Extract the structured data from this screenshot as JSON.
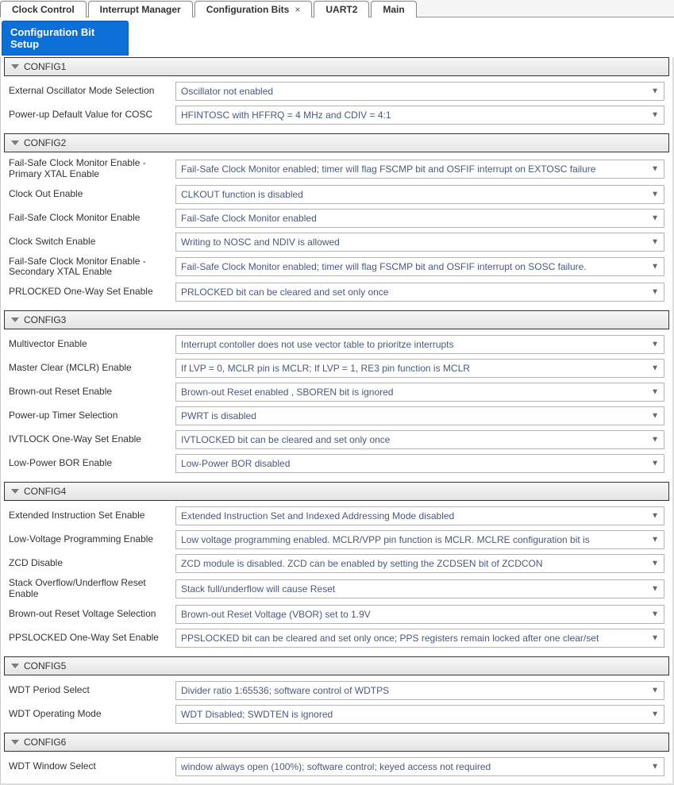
{
  "tabs": [
    {
      "label": "Clock Control",
      "active": false,
      "closable": false
    },
    {
      "label": "Interrupt Manager",
      "active": false,
      "closable": false
    },
    {
      "label": "Configuration Bits",
      "active": true,
      "closable": true
    },
    {
      "label": "UART2",
      "active": false,
      "closable": false
    },
    {
      "label": "Main",
      "active": false,
      "closable": false
    }
  ],
  "subheader": "Configuration Bit Setup",
  "sections": [
    {
      "title": "CONFIG1",
      "rows": [
        {
          "label": "External Oscillator Mode Selection",
          "value": "Oscillator not enabled"
        },
        {
          "label": "Power-up Default Value for COSC",
          "value": "HFINTOSC with HFFRQ = 4 MHz and CDIV = 4:1"
        }
      ]
    },
    {
      "title": "CONFIG2",
      "rows": [
        {
          "label": "Fail-Safe Clock Monitor Enable - Primary XTAL Enable",
          "value": "Fail-Safe Clock Monitor enabled; timer will flag FSCMP bit and OSFIF interrupt on EXTOSC failure"
        },
        {
          "label": "Clock Out Enable",
          "value": "CLKOUT function is disabled"
        },
        {
          "label": "Fail-Safe Clock Monitor Enable",
          "value": "Fail-Safe Clock Monitor enabled"
        },
        {
          "label": "Clock Switch Enable",
          "value": "Writing to NOSC and NDIV is allowed"
        },
        {
          "label": "Fail-Safe Clock Monitor Enable - Secondary XTAL Enable",
          "value": "Fail-Safe Clock Monitor enabled; timer will flag FSCMP bit and OSFIF interrupt on SOSC failure."
        },
        {
          "label": "PRLOCKED One-Way Set Enable",
          "value": "PRLOCKED bit can be cleared and set only once"
        }
      ]
    },
    {
      "title": "CONFIG3",
      "rows": [
        {
          "label": "Multivector Enable",
          "value": "Interrupt contoller does not use vector table to prioritze interrupts"
        },
        {
          "label": "Master Clear (MCLR) Enable",
          "value": "If LVP = 0, MCLR pin is MCLR; If LVP = 1, RE3 pin function is MCLR"
        },
        {
          "label": "Brown-out Reset Enable",
          "value": "Brown-out Reset enabled , SBOREN bit is ignored"
        },
        {
          "label": "Power-up Timer Selection",
          "value": "PWRT is disabled"
        },
        {
          "label": "IVTLOCK One-Way Set Enable",
          "value": "IVTLOCKED bit can be cleared and set only once"
        },
        {
          "label": "Low-Power BOR Enable",
          "value": "Low-Power BOR disabled"
        }
      ]
    },
    {
      "title": "CONFIG4",
      "rows": [
        {
          "label": "Extended Instruction Set Enable",
          "value": "Extended Instruction Set and Indexed Addressing Mode disabled"
        },
        {
          "label": "Low-Voltage Programming Enable",
          "value": "Low voltage programming enabled. MCLR/VPP pin function is MCLR. MCLRE configuration bit is"
        },
        {
          "label": "ZCD Disable",
          "value": "ZCD module is disabled. ZCD can be enabled by setting the ZCDSEN bit of ZCDCON"
        },
        {
          "label": "Stack Overflow/Underflow Reset Enable",
          "value": "Stack full/underflow will cause Reset"
        },
        {
          "label": "Brown-out Reset Voltage Selection",
          "value": "Brown-out Reset Voltage (VBOR) set to 1.9V"
        },
        {
          "label": "PPSLOCKED One-Way Set Enable",
          "value": "PPSLOCKED bit can be cleared and set only once; PPS registers remain locked after one clear/set"
        }
      ]
    },
    {
      "title": "CONFIG5",
      "rows": [
        {
          "label": "WDT Period Select",
          "value": "Divider ratio 1:65536; software control of WDTPS"
        },
        {
          "label": "WDT Operating Mode",
          "value": "WDT Disabled; SWDTEN is ignored"
        }
      ]
    },
    {
      "title": "CONFIG6",
      "rows": [
        {
          "label": "WDT Window Select",
          "value": "window always open (100%); software control; keyed access not required"
        }
      ]
    }
  ]
}
